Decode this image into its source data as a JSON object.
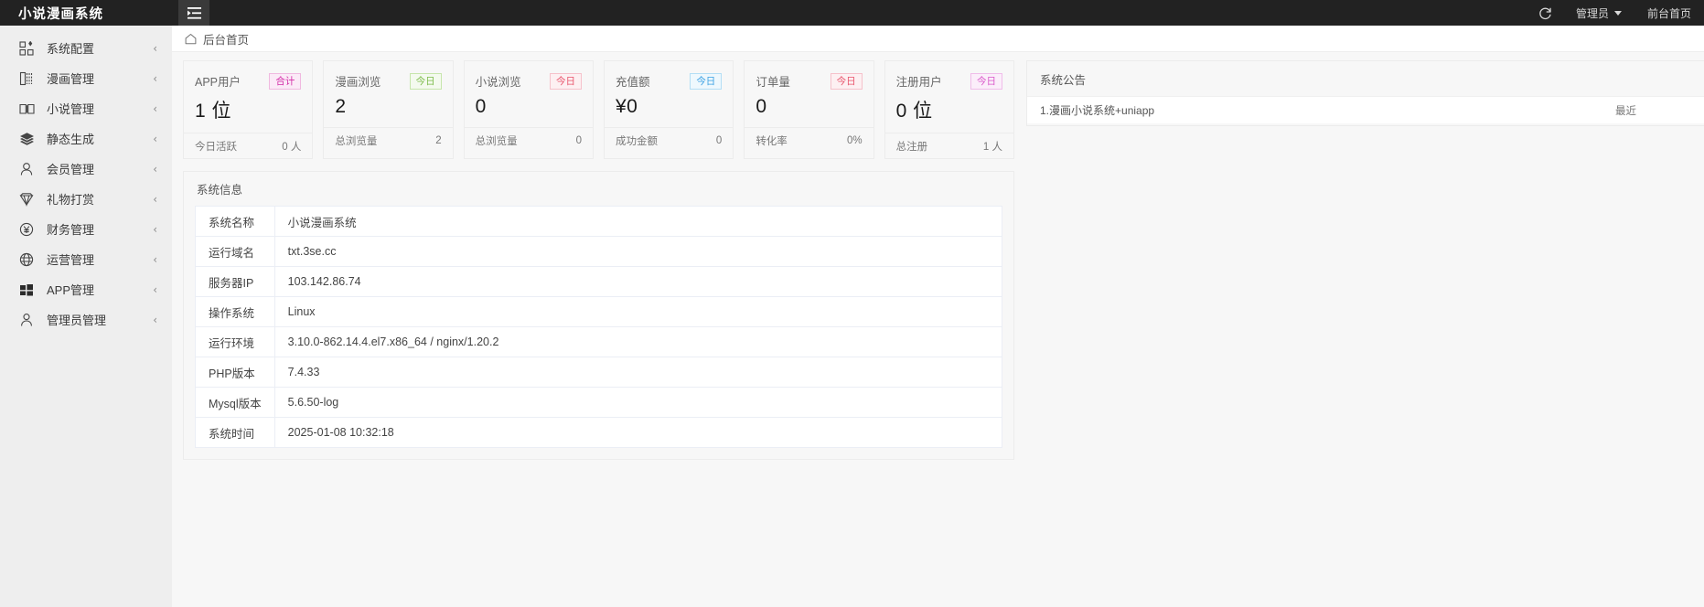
{
  "header": {
    "brand": "小说漫画系统",
    "collapse_icon": "menu-fold-icon",
    "refresh_icon": "refresh-icon",
    "admin_label": "管理员",
    "frontend_label": "前台首页"
  },
  "sidebar": {
    "items": [
      {
        "label": "系统配置",
        "icon": "apps-grid-icon",
        "arrow": "‹"
      },
      {
        "label": "漫画管理",
        "icon": "comic-book-icon",
        "arrow": "‹"
      },
      {
        "label": "小说管理",
        "icon": "open-book-icon",
        "arrow": "‹"
      },
      {
        "label": "静态生成",
        "icon": "layers-icon",
        "arrow": "‹"
      },
      {
        "label": "会员管理",
        "icon": "user-circle-icon",
        "arrow": "‹"
      },
      {
        "label": "礼物打赏",
        "icon": "diamond-icon",
        "arrow": "‹"
      },
      {
        "label": "财务管理",
        "icon": "yen-circle-icon",
        "arrow": "‹"
      },
      {
        "label": "运营管理",
        "icon": "globe-icon",
        "arrow": "‹"
      },
      {
        "label": "APP管理",
        "icon": "windows-blocks-icon",
        "arrow": "‹"
      },
      {
        "label": "管理员管理",
        "icon": "user-icon",
        "arrow": "‹"
      }
    ]
  },
  "breadcrumb": {
    "home_icon": "home-icon",
    "label": "后台首页"
  },
  "cards": [
    {
      "title": "APP用户",
      "badge": "合计",
      "badge_color": "#d32fa8",
      "badge_bg": "#fbeaf7",
      "badge_border": "#f0b9e0",
      "value": "1 位",
      "foot_label": "今日活跃",
      "foot_value": "0 人"
    },
    {
      "title": "漫画浏览",
      "badge": "今日",
      "badge_color": "#7cbb4a",
      "badge_bg": "#f4faef",
      "badge_border": "#c7e6ac",
      "value": "2",
      "foot_label": "总浏览量",
      "foot_value": "2"
    },
    {
      "title": "小说浏览",
      "badge": "今日",
      "badge_color": "#e8536b",
      "badge_bg": "#fdf0f2",
      "badge_border": "#f6c2cb",
      "value": "0",
      "foot_label": "总浏览量",
      "foot_value": "0"
    },
    {
      "title": "充值额",
      "badge": "今日",
      "badge_color": "#3aa0e3",
      "badge_bg": "#eef8fd",
      "badge_border": "#b3def5",
      "value": "¥0",
      "foot_label": "成功金额",
      "foot_value": "0"
    },
    {
      "title": "订单量",
      "badge": "今日",
      "badge_color": "#e8536b",
      "badge_bg": "#fdf0f2",
      "badge_border": "#f6c2cb",
      "value": "0",
      "foot_label": "转化率",
      "foot_value": "0%"
    },
    {
      "title": "注册用户",
      "badge": "今日",
      "badge_color": "#d957c9",
      "badge_bg": "#fbeefa",
      "badge_border": "#f0bdea",
      "value": "0 位",
      "foot_label": "总注册",
      "foot_value": "1 人"
    }
  ],
  "sysinfo": {
    "title": "系统信息",
    "rows": [
      {
        "key": "系统名称",
        "value": "小说漫画系统"
      },
      {
        "key": "运行域名",
        "value": "txt.3se.cc"
      },
      {
        "key": "服务器IP",
        "value": "103.142.86.74"
      },
      {
        "key": "操作系统",
        "value": "Linux"
      },
      {
        "key": "运行环境",
        "value": "3.10.0-862.14.4.el7.x86_64 / nginx/1.20.2"
      },
      {
        "key": "PHP版本",
        "value": "7.4.33"
      },
      {
        "key": "Mysql版本",
        "value": "5.6.50-log"
      },
      {
        "key": "系统时间",
        "value": "2025-01-08 10:32:18"
      }
    ]
  },
  "notice": {
    "title": "系统公告",
    "rows": [
      {
        "text": "1.漫画小说系统+uniapp",
        "time": "最近"
      }
    ]
  }
}
